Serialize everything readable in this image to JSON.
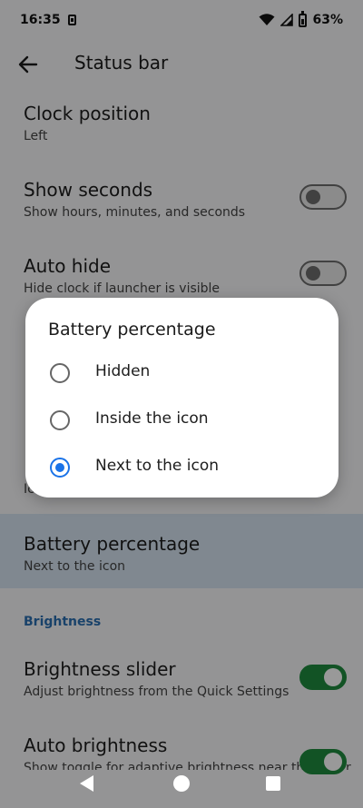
{
  "status_bar": {
    "time": "16:35",
    "battery_percent": "63%"
  },
  "app_bar": {
    "title": "Status bar",
    "back_icon": "arrow-back-icon"
  },
  "settings": {
    "clock_position": {
      "title": "Clock position",
      "summary": "Left"
    },
    "show_seconds": {
      "title": "Show seconds",
      "summary": "Show hours, minutes, and seconds",
      "enabled": false
    },
    "auto_hide": {
      "title": "Auto hide",
      "summary": "Hide clock if launcher is visible",
      "enabled": false
    },
    "hidden_row_summary_fragment": "Ic",
    "battery_percentage": {
      "title": "Battery percentage",
      "summary": "Next to the icon"
    },
    "brightness_header": "Brightness",
    "brightness_slider": {
      "title": "Brightness slider",
      "summary": "Adjust brightness from the Quick Settings",
      "enabled": true
    },
    "auto_brightness": {
      "title": "Auto brightness",
      "summary": "Show toggle for adaptive brightness near the slider",
      "enabled": true
    }
  },
  "dialog": {
    "title": "Battery percentage",
    "options": [
      {
        "label": "Hidden",
        "selected": false
      },
      {
        "label": "Inside the icon",
        "selected": false
      },
      {
        "label": "Next to the icon",
        "selected": true
      }
    ],
    "accent_color": "#1a73e8"
  },
  "nav_bar": {
    "icons": [
      "nav-back-icon",
      "nav-home-icon",
      "nav-recents-icon"
    ]
  },
  "colors": {
    "toggle_on": "#1e8b3e",
    "section_header": "#2b6fb1",
    "highlight_row": "#d5e3f0"
  }
}
